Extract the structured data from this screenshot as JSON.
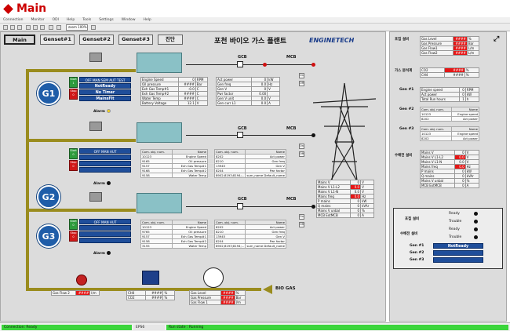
{
  "page": {
    "title": "Main",
    "accent": "#c00000"
  },
  "menu": [
    "Connection",
    "Monitor",
    "ODI",
    "Help",
    "Tools",
    "Settings",
    "Window",
    "Help"
  ],
  "toolbar": {
    "zoom": "zoom 100%"
  },
  "tabs": [
    "Main",
    "Genset#1",
    "Genset#2",
    "Genset#3",
    "진단"
  ],
  "plant_title": "포천 바이오 가스 플랜트",
  "logo": "ENGINETECH",
  "gcb": "GCB",
  "mcb": "MCB",
  "on": "On",
  "off": "Off",
  "g1": {
    "label": "G1",
    "start": "Start",
    "start_val": "1",
    "stop": "Stop",
    "stop_val": "0",
    "modes": "OFF MAN SEM AUT TEST",
    "status": [
      "NotReady",
      "No Timer",
      "MainsFlt"
    ],
    "alarm": "Alarm",
    "alarm_color": "#f2d21a",
    "engine": [
      [
        "Engine Speed",
        "0",
        "RPM"
      ],
      [
        "Oil pressure",
        "####",
        "Bar"
      ],
      [
        "Exh Gas Temp#1",
        "-0.0",
        "C"
      ],
      [
        "Exh Gas Temp#2",
        "####",
        "C"
      ],
      [
        "Water Temp",
        "####",
        "C"
      ],
      [
        "Battery Voltage",
        "12.1",
        "V"
      ]
    ],
    "power": [
      [
        "Act power",
        "0",
        "kW"
      ],
      [
        "Gen freq",
        "0.0",
        "Hz"
      ],
      [
        "Gen V",
        "0",
        "V"
      ],
      [
        "Pwr factor",
        "0.00",
        ""
      ],
      [
        "Gen V unit",
        "0.0",
        "V"
      ],
      [
        "Gen curr L1",
        "0.0",
        "A"
      ]
    ]
  },
  "g2": {
    "label": "G2",
    "start": "Start",
    "start_val": "0",
    "stop": "Stop",
    "stop_val": "0",
    "modes": "OFF MAN AUT",
    "alarm": "Alarm",
    "alarm_color": "#111111",
    "engine": [
      [
        "Com. obj. num.",
        "Name"
      ],
      [
        "10123",
        "Engine Speed"
      ],
      [
        "9165",
        "Oil pressure"
      ],
      [
        "9157",
        "Exh Gas Temp#1"
      ],
      [
        "9168",
        "Exh Gas Temp#2"
      ],
      [
        "9158",
        "Water Temp"
      ]
    ],
    "power": [
      [
        "Com. obj. num.",
        "Name"
      ],
      [
        "8202",
        "Act power"
      ],
      [
        "8210",
        "Gen freq"
      ],
      [
        "13945",
        "Gen V"
      ],
      [
        "8204",
        "Pwr factor"
      ],
      [
        "8902;8193;8194;...",
        "sum_name Default_name"
      ]
    ]
  },
  "g3": {
    "label": "G3",
    "start": "Start",
    "start_val": "0",
    "stop": "Stop",
    "stop_val": "0",
    "modes": "OFF MAN AUT",
    "alarm": "Alarm",
    "alarm_color": "#111111",
    "engine": [
      [
        "Com. obj. num.",
        "Name"
      ],
      [
        "10123",
        "Engine Speed"
      ],
      [
        "9765",
        "Oil pressure"
      ],
      [
        "9157",
        "Exh Gas Temp#1"
      ],
      [
        "9158",
        "Exh Gas Temp#2"
      ],
      [
        "3155",
        "Water Temp"
      ]
    ],
    "power": [
      [
        "Com. obj. num.",
        "Name"
      ],
      [
        "8202",
        "Act power"
      ],
      [
        "8210",
        "Gen freq"
      ],
      [
        "13945",
        "Gen V"
      ],
      [
        "8204",
        "Pwr factor"
      ],
      [
        "8902;8193;8194;...",
        "sum_name Default_name"
      ]
    ]
  },
  "mains": [
    [
      "Mains V",
      "0",
      "V"
    ],
    [
      "Mains V L1-L2",
      "0.0",
      "V"
    ],
    [
      "Mains V L1-N",
      "0.0",
      "V"
    ],
    [
      "Mains freq",
      "0.0",
      "Hz"
    ],
    [
      "P mains",
      "0",
      "kW"
    ],
    [
      "Q mains",
      "0",
      "kVAr"
    ],
    [
      "Mains V unbal",
      "0",
      "%"
    ],
    [
      "MCB ExtMCB",
      "0",
      "A"
    ]
  ],
  "bottom": {
    "gas_flow2": [
      "Gas Flow 2",
      "####",
      "l/m"
    ],
    "ch4": [
      "CH4",
      "####",
      "%"
    ],
    "co2": [
      "CO2",
      "####",
      "%"
    ],
    "gas_level": [
      "Gas Level",
      "####",
      "%"
    ],
    "gas_pressure": [
      "Gas Pressure",
      "####",
      "Bar"
    ],
    "gas_flow1": [
      "Gas Flow 1",
      "####",
      "l/m"
    ],
    "bio_gas": "BIO GAS"
  },
  "right": {
    "fuel_title": "포집 설비",
    "fuel": [
      [
        "Gas Level",
        "####",
        "%"
      ],
      [
        "Gas Pressure",
        "####",
        "Bar"
      ],
      [
        "Gas Flow1",
        "####",
        "L/m"
      ],
      [
        "Gas Flow2",
        "####",
        "L/m"
      ]
    ],
    "analyzer_title": "가스 분석계",
    "analyzer": [
      [
        "CO2",
        "####",
        "%"
      ],
      [
        "CH4",
        "####",
        "%"
      ]
    ],
    "gen1_title": "Gen #1",
    "gen1": [
      [
        "Engine speed",
        "0",
        "RPM"
      ],
      [
        "Act power",
        "0",
        "kW"
      ],
      [
        "Total Run hours",
        "1",
        "h"
      ]
    ],
    "gen2_title": "Gen #2",
    "gen2": [
      [
        "Com. obj. num.",
        "Name"
      ],
      [
        "10123",
        "Engine speed"
      ],
      [
        "8202",
        "Act power"
      ]
    ],
    "gen3_title": "Gen #3",
    "gen3": [
      [
        "Com. obj. num.",
        "Name"
      ],
      [
        "10123",
        "Engine speed"
      ],
      [
        "8202",
        "Act power"
      ]
    ],
    "mains_title": "수배전 설비",
    "mains": [
      [
        "Mains V",
        "0",
        "V"
      ],
      [
        "Mains V L1-L2",
        "0.0",
        "V"
      ],
      [
        "Mains V L1-N",
        "0.0",
        "V"
      ],
      [
        "Mains freq",
        "0.0",
        "Hz"
      ],
      [
        "P mains",
        "0",
        "kW"
      ],
      [
        "Q mains",
        "0",
        "kVAr"
      ],
      [
        "Mains V unbal",
        "0",
        "%"
      ],
      [
        "MCB ExtMCB",
        "0",
        "A"
      ]
    ],
    "status": [
      [
        "포집 설비",
        "Ready"
      ],
      [
        "",
        "Trouble"
      ],
      [
        "수배전 설비",
        "Ready"
      ],
      [
        "",
        "Trouble"
      ]
    ],
    "gens": [
      [
        "Gen #1",
        "NotReady"
      ],
      [
        "Gen #2",
        ""
      ],
      [
        "Gen #3",
        ""
      ]
    ]
  },
  "statusbar": {
    "left": "Connection: Ready",
    "mid": "EPS6",
    "right": "Run state : Running"
  }
}
